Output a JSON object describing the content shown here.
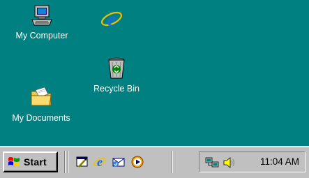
{
  "desktop": {
    "icons": [
      {
        "label": "My Computer",
        "icon": "my-computer-icon"
      },
      {
        "label": "",
        "icon": "internet-explorer-icon"
      },
      {
        "label": "Recycle Bin",
        "icon": "recycle-bin-icon"
      },
      {
        "label": "My Documents",
        "icon": "my-documents-icon"
      }
    ]
  },
  "taskbar": {
    "start_label": "Start",
    "quick_launch": [
      "show-desktop-icon",
      "internet-explorer-icon",
      "outlook-express-icon",
      "windows-media-player-icon"
    ],
    "tray": {
      "icons": [
        "network-connection-icon",
        "volume-speaker-icon"
      ],
      "clock": "11:04 AM"
    }
  },
  "colors": {
    "desktop_bg": "#008080",
    "taskbar_bg": "#c0c0c0"
  }
}
